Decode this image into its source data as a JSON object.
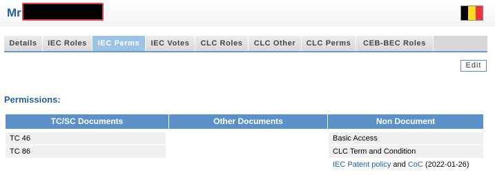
{
  "header": {
    "title_prefix": "Mr",
    "flag_colors": [
      "#000000",
      "#FDDA24",
      "#EF3340"
    ]
  },
  "tabs": [
    {
      "label": "Details",
      "active": false
    },
    {
      "label": "IEC Roles",
      "active": false
    },
    {
      "label": "IEC Perms",
      "active": true
    },
    {
      "label": "IEC Votes",
      "active": false
    },
    {
      "label": "CLC Roles",
      "active": false
    },
    {
      "label": "CLC Other",
      "active": false
    },
    {
      "label": "CLC Perms",
      "active": false
    },
    {
      "label": "CEB-BEC Roles",
      "active": false
    }
  ],
  "edit_label": "Edit",
  "permissions": {
    "title": "Permissions:",
    "columns": [
      "TC/SC Documents",
      "Other Documents",
      "Non Document"
    ],
    "tc_sc_documents": [
      "TC 46",
      "TC 86"
    ],
    "other_documents": [],
    "non_document": {
      "row1": "Basic Access",
      "row2": "CLC Term and Condition",
      "row3": {
        "link1": "IEC Patent policy",
        "and_text": " and ",
        "link2": "CoC",
        "date_text": " (2022-01-26)"
      }
    }
  }
}
